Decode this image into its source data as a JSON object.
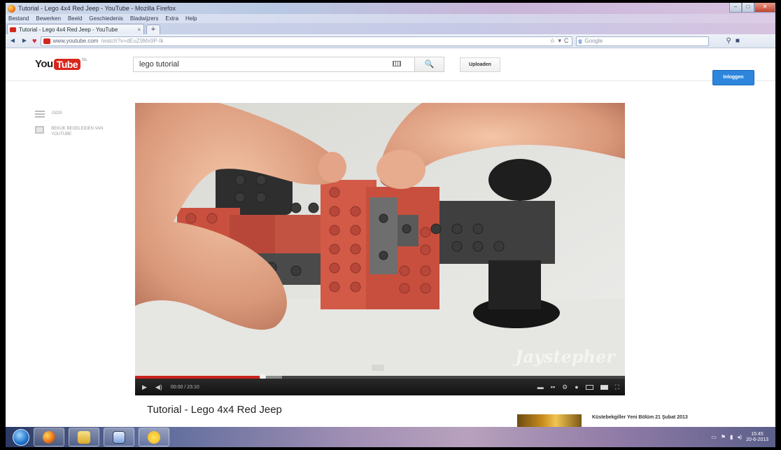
{
  "window": {
    "title": "Tutorial - Lego 4x4 Red Jeep - YouTube - Mozilla Firefox",
    "min": "–",
    "max": "□",
    "close": "✕"
  },
  "menu": [
    "Bestand",
    "Bewerken",
    "Beeld",
    "Geschiedenis",
    "Bladwijzers",
    "Extra",
    "Help"
  ],
  "tab": {
    "title": "Tutorial - Lego 4x4 Red Jeep - YouTube",
    "close": "×",
    "new": "+"
  },
  "nav": {
    "url_host": "www.youtube.com",
    "url_path": "/watch?v=dEuZ9Mx9P-Ik",
    "search_engine": "Google"
  },
  "youtube": {
    "logo_you": "You",
    "logo_tube": "Tube",
    "logo_region": "NL",
    "search_value": "lego tutorial",
    "search_btn": "🔍",
    "upload": "Uploaden",
    "login": "Inloggen",
    "guide": [
      {
        "label": "GIDS",
        "icon": "hamburger-icon"
      },
      {
        "label": "BEKIJK BEGELEIDEN VAN YOUTUBE",
        "icon": "library-icon"
      }
    ]
  },
  "video": {
    "watermark": "Jaystepher",
    "time_current": "00:00",
    "time_total": "23:10",
    "title": "Tutorial - Lego 4x4 Red Jeep",
    "progress_played": 0.26,
    "progress_loaded": 0.3
  },
  "suggestion": {
    "title": "Küstebekgiller Yeni Bölüm 21 Şubat 2013"
  },
  "taskbar": {
    "clock_time": "15:45",
    "clock_date": "20-6-2013"
  },
  "colors": {
    "youtube_red": "#d8261b",
    "login_blue": "#2d86dc",
    "progress_red": "#c9231c"
  }
}
